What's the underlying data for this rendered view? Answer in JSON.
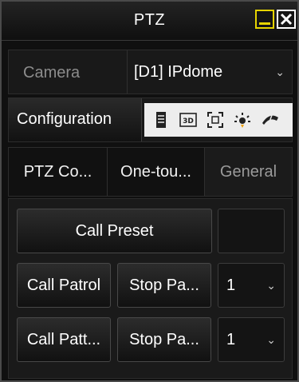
{
  "window": {
    "title": "PTZ",
    "minimize_icon": "minimize-icon",
    "close_icon": "close-icon"
  },
  "camera": {
    "label": "Camera",
    "selected": "[D1] IPdome",
    "dropdown_icon": "chevron-down-icon"
  },
  "toolbar": {
    "config_label": "Configuration",
    "icons": [
      "document-icon",
      "3d-icon",
      "focus-frame-icon",
      "light-icon",
      "wiper-icon"
    ]
  },
  "tabs": [
    "PTZ Co...",
    "One-tou...",
    "General"
  ],
  "controls": {
    "call_preset_label": "Call Preset",
    "preset_number_value": "",
    "call_patrol_label": "Call Patrol",
    "stop_patrol_label": "Stop Pa...",
    "patrol_number": "1",
    "call_pattern_label": "Call Patt...",
    "stop_pattern_label": "Stop Pa...",
    "pattern_number": "1"
  },
  "colors": {
    "background": "#101010",
    "minimize_accent": "#e6d400",
    "inactive_text": "#8c8c8c"
  }
}
